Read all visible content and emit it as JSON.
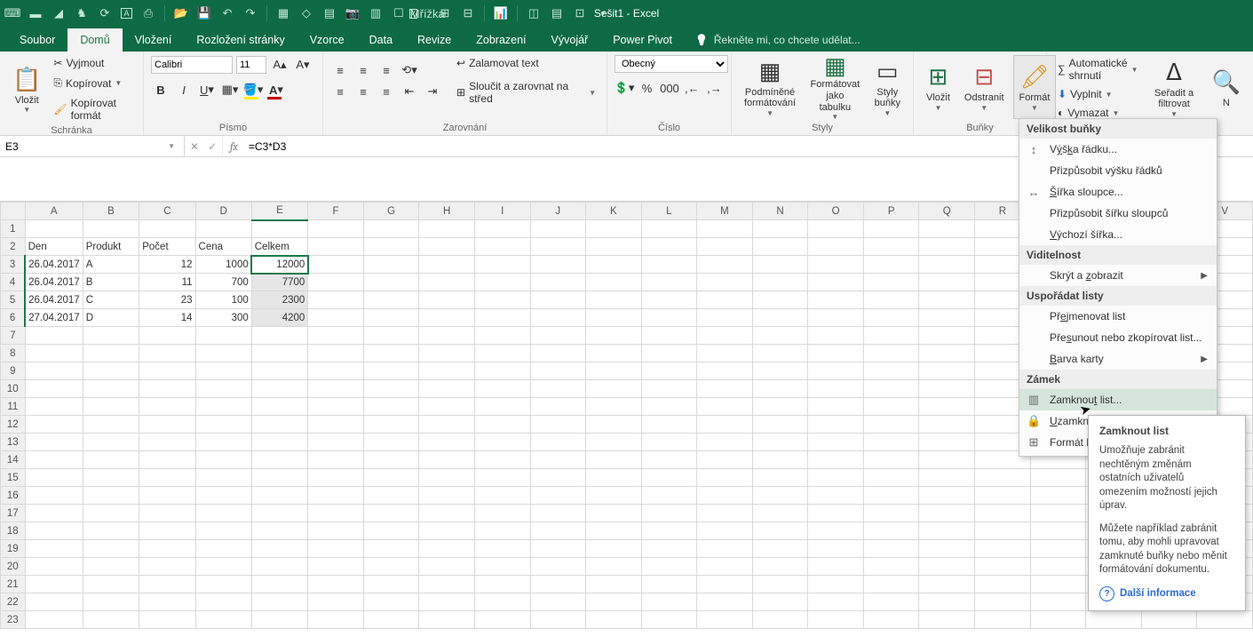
{
  "app": {
    "title": "Sešit1 - Excel"
  },
  "qat": {
    "grid_label": "Mřížka"
  },
  "tabs": {
    "file": "Soubor",
    "home": "Domů",
    "insert": "Vložení",
    "layout": "Rozložení stránky",
    "formulas": "Vzorce",
    "data": "Data",
    "review": "Revize",
    "view": "Zobrazení",
    "developer": "Vývojář",
    "powerpivot": "Power Pivot",
    "tellme": "Řekněte mi, co chcete udělat..."
  },
  "ribbon": {
    "clipboard": {
      "label": "Schránka",
      "paste": "Vložit",
      "cut": "Vyjmout",
      "copy": "Kopírovat",
      "painter": "Kopírovat formát"
    },
    "font": {
      "label": "Písmo",
      "name": "Calibri",
      "size": "11"
    },
    "alignment": {
      "label": "Zarovnání",
      "wrap": "Zalamovat text",
      "merge": "Sloučit a zarovnat na střed"
    },
    "number": {
      "label": "Číslo",
      "format": "Obecný"
    },
    "styles": {
      "label": "Styly",
      "cond": "Podmíněné formátování",
      "table": "Formátovat jako tabulku",
      "cell": "Styly buňky"
    },
    "cells": {
      "label": "Buňky",
      "insert": "Vložit",
      "delete": "Odstranit",
      "format": "Formát"
    },
    "editing": {
      "label": "",
      "autosum": "Automatické shrnutí",
      "fill": "Vyplnit",
      "clear": "Vymazat",
      "sort": "Seřadit a filtrovat",
      "find": "N"
    }
  },
  "formulaBar": {
    "cellRef": "E3",
    "formula": "=C3*D3"
  },
  "gridHeaders": {
    "cols": [
      "A",
      "B",
      "C",
      "D",
      "E",
      "F",
      "G",
      "H",
      "I",
      "J",
      "K",
      "L",
      "M",
      "N",
      "O",
      "P",
      "Q",
      "R",
      "S",
      "T",
      "U",
      "V"
    ]
  },
  "sheet": {
    "headerRow": [
      "Den",
      "Produkt",
      "Počet",
      "Cena",
      "Celkem"
    ],
    "rows": [
      [
        "26.04.2017",
        "A",
        "12",
        "1000",
        "12000"
      ],
      [
        "26.04.2017",
        "B",
        "11",
        "700",
        "7700"
      ],
      [
        "26.04.2017",
        "C",
        "23",
        "100",
        "2300"
      ],
      [
        "27.04.2017",
        "D",
        "14",
        "300",
        "4200"
      ]
    ]
  },
  "formatMenu": {
    "sec_cellSize": "Velikost buňky",
    "rowHeight": "Výška řádku...",
    "autoRowHeight": "Přizpůsobit výšku řádků",
    "colWidth": "Šířka sloupce...",
    "autoColWidth": "Přizpůsobit šířku sloupců",
    "defaultWidth": "Výchozí šířka...",
    "sec_visibility": "Viditelnost",
    "hideShow": "Skrýt a zobrazit",
    "sec_organize": "Uspořádat listy",
    "rename": "Přejmenovat list",
    "move": "Přesunout nebo zkopírovat list...",
    "tabColor": "Barva karty",
    "sec_lock": "Zámek",
    "lockSheet": "Zamknout list...",
    "lockCell": "Uzamkno",
    "formatCells": "Formát b"
  },
  "tooltip": {
    "title": "Zamknout list",
    "p1": "Umožňuje zabránit nechtěným změnám ostatních uživatelů omezením možností jejich úprav.",
    "p2": "Můžete například zabránit tomu, aby mohli upravovat zamknuté buňky nebo měnit formátování dokumentu.",
    "more": "Další informace"
  }
}
